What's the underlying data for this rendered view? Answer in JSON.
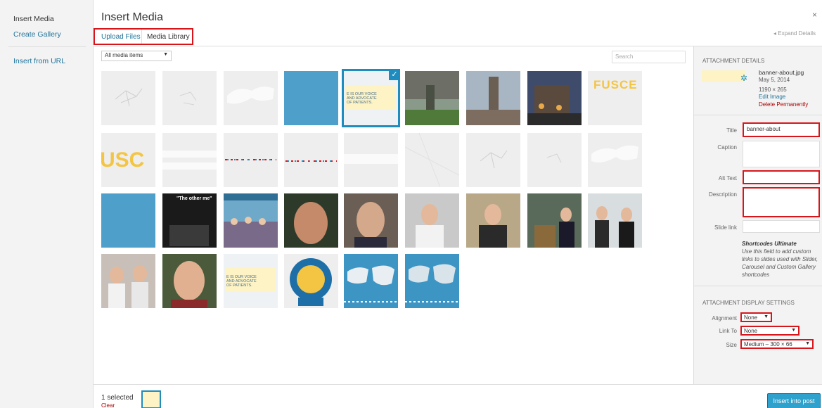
{
  "menu": {
    "active": "Insert Media",
    "create_gallery": "Create Gallery",
    "insert_url": "Insert from URL"
  },
  "title": "Insert Media",
  "close": "×",
  "expand": "Expand Details",
  "router": {
    "upload": "Upload Files",
    "library": "Media Library"
  },
  "filter": {
    "selected": "All media items"
  },
  "search": {
    "placeholder": "Search"
  },
  "grid": {
    "selected_text": "E IS OUR VOICE\nAND ADVOCATE\nOF PATIENTS.",
    "fusce": "FUSCE",
    "usc": "USC"
  },
  "details": {
    "heading": "Attachment Details",
    "filename": "banner-about.jpg",
    "date": "May 5, 2014",
    "dims": "1190 × 265",
    "edit": "Edit Image",
    "delete": "Delete Permanently",
    "title_label": "Title",
    "title_value": "banner-about",
    "caption_label": "Caption",
    "alt_label": "Alt Text",
    "desc_label": "Description",
    "slide_label": "Slide link",
    "help_title": "Shortcodes Ultimate",
    "help_text": "Use this field to add custom links to slides used with Slider, Carousel and Custom Gallery shortcodes"
  },
  "display": {
    "heading": "Attachment Display Settings",
    "align_label": "Alignment",
    "align_value": "None",
    "link_label": "Link To",
    "link_value": "None",
    "size_label": "Size",
    "size_value": "Medium – 300 × 66"
  },
  "footer": {
    "count": "1 selected",
    "clear": "Clear",
    "insert": "Insert into post"
  },
  "colors": {
    "accent": "#1e8cbe",
    "highlight": "#d7161c",
    "link": "#21759b"
  }
}
